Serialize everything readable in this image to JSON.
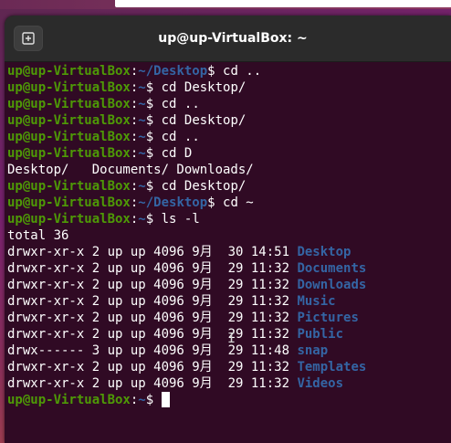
{
  "window": {
    "title": "up@up-VirtualBox: ~"
  },
  "terminal": {
    "user_host": "up@up-VirtualBox",
    "lines": [
      {
        "kind": "prompt",
        "path": "~/Desktop",
        "cmd": " cd .."
      },
      {
        "kind": "prompt",
        "path": "~",
        "cmd": " cd Desktop/"
      },
      {
        "kind": "prompt",
        "path": "~",
        "cmd": " cd .."
      },
      {
        "kind": "prompt",
        "path": "~",
        "cmd": " cd Desktop/"
      },
      {
        "kind": "prompt",
        "path": "~",
        "cmd": " cd .."
      },
      {
        "kind": "prompt",
        "path": "~",
        "cmd": " cd D"
      },
      {
        "kind": "text",
        "text": "Desktop/   Documents/ Downloads/"
      },
      {
        "kind": "prompt",
        "path": "~",
        "cmd": " cd Desktop/"
      },
      {
        "kind": "prompt",
        "path": "~/Desktop",
        "cmd": " cd ~"
      },
      {
        "kind": "prompt",
        "path": "~",
        "cmd": " ls -l"
      },
      {
        "kind": "text",
        "text": "total 36"
      },
      {
        "kind": "ls",
        "info": "drwxr-xr-x 2 up up 4096 9月  30 14:51 ",
        "name": "Desktop"
      },
      {
        "kind": "ls",
        "info": "drwxr-xr-x 2 up up 4096 9月  29 11:32 ",
        "name": "Documents"
      },
      {
        "kind": "ls",
        "info": "drwxr-xr-x 2 up up 4096 9月  29 11:32 ",
        "name": "Downloads"
      },
      {
        "kind": "ls",
        "info": "drwxr-xr-x 2 up up 4096 9月  29 11:32 ",
        "name": "Music"
      },
      {
        "kind": "ls",
        "info": "drwxr-xr-x 2 up up 4096 9月  29 11:32 ",
        "name": "Pictures"
      },
      {
        "kind": "ls",
        "info": "drwxr-xr-x 2 up up 4096 9月  29 11:32 ",
        "name": "Public"
      },
      {
        "kind": "ls",
        "info": "drwx------ 3 up up 4096 9月  29 11:48 ",
        "name": "snap"
      },
      {
        "kind": "ls",
        "info": "drwxr-xr-x 2 up up 4096 9月  29 11:32 ",
        "name": "Templates"
      },
      {
        "kind": "ls",
        "info": "drwxr-xr-x 2 up up 4096 9月  29 11:32 ",
        "name": "Videos"
      },
      {
        "kind": "prompt",
        "path": "~",
        "cmd": " ",
        "cursor": true
      }
    ]
  },
  "icons": {
    "new_tab": "new-tab-icon",
    "mouse": "ibeam-cursor-icon"
  },
  "colors": {
    "background": "#300a24",
    "user": "#4e9a06",
    "path": "#3465a4",
    "titlebar": "#2b2b2b"
  }
}
